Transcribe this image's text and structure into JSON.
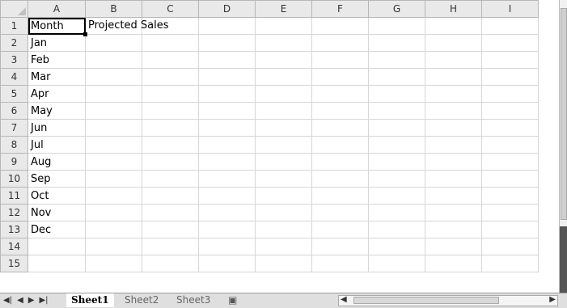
{
  "columns": [
    "A",
    "B",
    "C",
    "D",
    "E",
    "F",
    "G",
    "H",
    "I"
  ],
  "rows": [
    {
      "num": "1",
      "a": "Month",
      "b": "Projected Sales"
    },
    {
      "num": "2",
      "a": "Jan",
      "b": ""
    },
    {
      "num": "3",
      "a": "Feb",
      "b": ""
    },
    {
      "num": "4",
      "a": "Mar",
      "b": ""
    },
    {
      "num": "5",
      "a": "Apr",
      "b": ""
    },
    {
      "num": "6",
      "a": "May",
      "b": ""
    },
    {
      "num": "7",
      "a": "Jun",
      "b": ""
    },
    {
      "num": "8",
      "a": "Jul",
      "b": ""
    },
    {
      "num": "9",
      "a": "Aug",
      "b": ""
    },
    {
      "num": "10",
      "a": "Sep",
      "b": ""
    },
    {
      "num": "11",
      "a": "Oct",
      "b": ""
    },
    {
      "num": "12",
      "a": "Nov",
      "b": ""
    },
    {
      "num": "13",
      "a": "Dec",
      "b": ""
    },
    {
      "num": "14",
      "a": "",
      "b": ""
    },
    {
      "num": "15",
      "a": "",
      "b": ""
    }
  ],
  "tabs": [
    "Sheet1",
    "Sheet2",
    "Sheet3"
  ],
  "nav_icons": [
    "first-sheet-icon",
    "prev-sheet-icon",
    "next-sheet-icon",
    "last-sheet-icon"
  ],
  "colors": {
    "header_bg": "#e9e9e9",
    "gridline": "#d6d6d6",
    "tabbar_bg": "#dfdfdf"
  }
}
